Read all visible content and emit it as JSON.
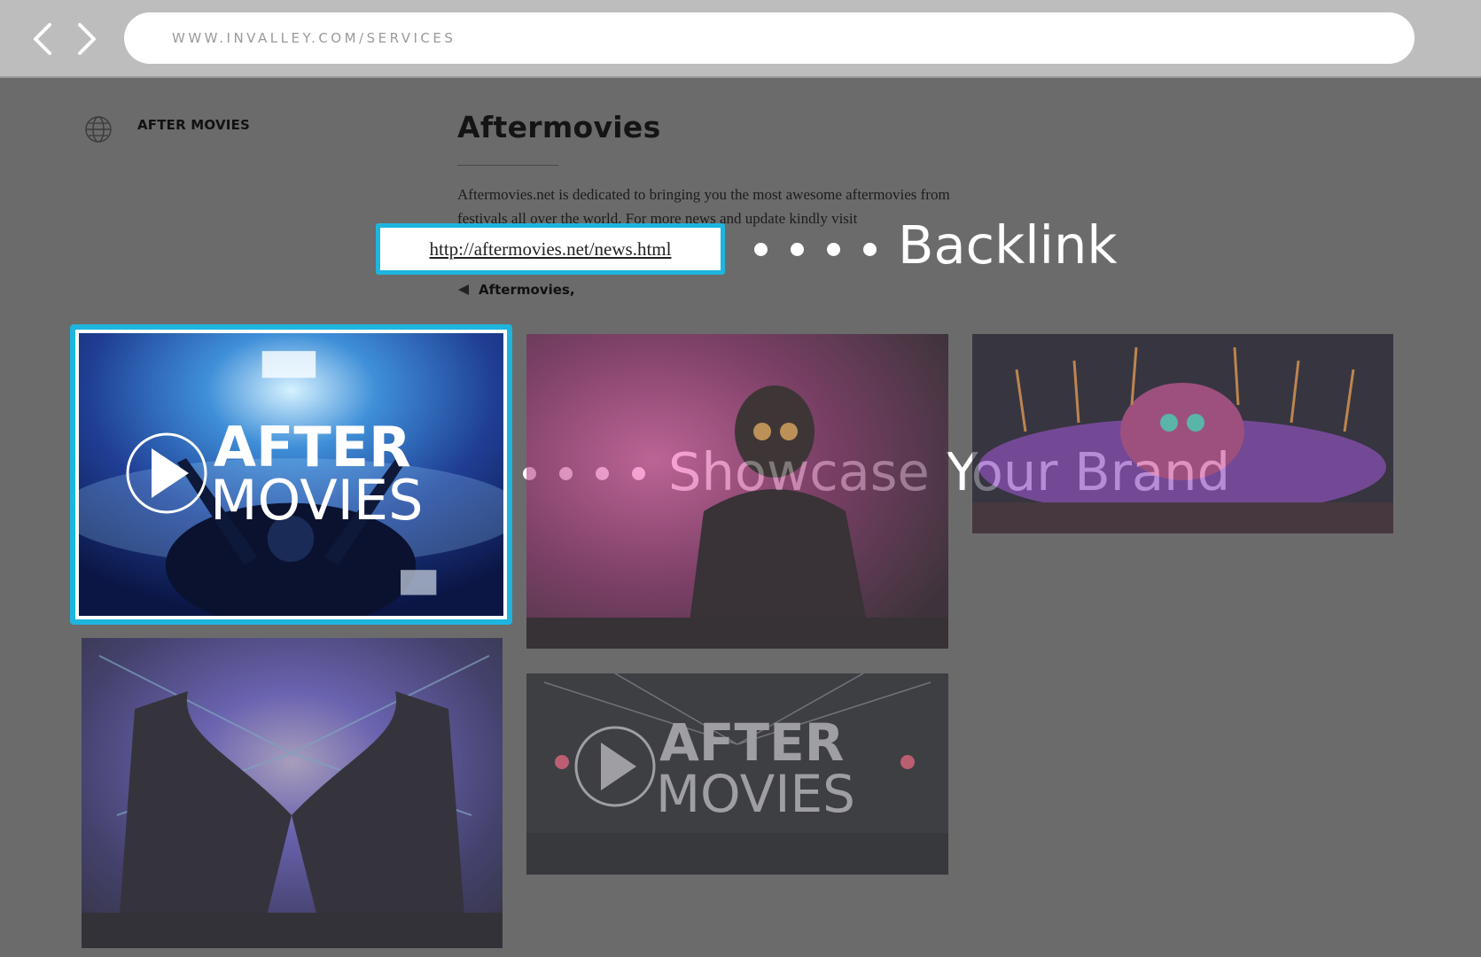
{
  "browser": {
    "back_label": "Back",
    "forward_label": "Forward",
    "url": "WWW.INVALLEY.COM/SERVICES"
  },
  "sidebar": {
    "category": "AFTER MOVIES",
    "icon": "globe-icon"
  },
  "main": {
    "title": "Aftermovies",
    "description": "Aftermovies.net is dedicated to bringing you the most awesome aftermovies from festivals all over the world. For more news and update kindly visit",
    "link": "http://aftermovies.net/news.html",
    "tag": "Aftermovies,"
  },
  "callouts": {
    "backlink": "Backlink",
    "brand": "Showcase Your Brand"
  },
  "gallery": {
    "logo_top": "AFTER",
    "logo_bottom": "MOVIES"
  },
  "colors": {
    "accent": "#1eb5df",
    "overlay": "#6b6b6b",
    "topbar": "#bdbdbd"
  }
}
